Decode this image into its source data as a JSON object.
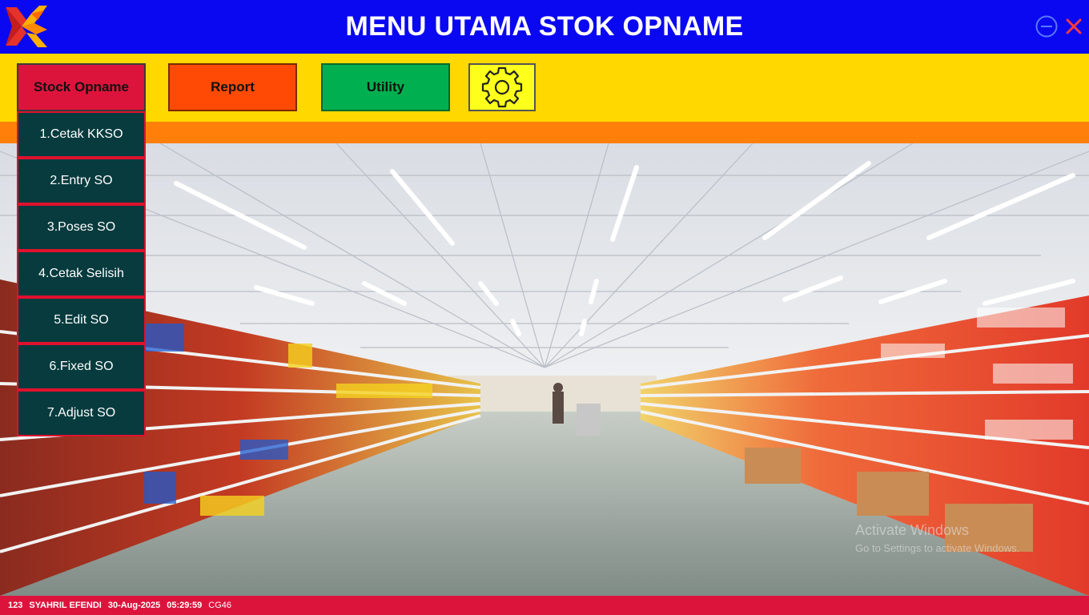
{
  "window": {
    "title": "MENU UTAMA STOK OPNAME",
    "minimize_icon": "minimize-circle-icon",
    "close_icon": "close-icon"
  },
  "toolbar": {
    "stock_opname_label": "Stock Opname",
    "report_label": "Report",
    "utility_label": "Utility",
    "settings_icon": "gear-icon"
  },
  "dropdown": {
    "items": [
      {
        "label": "1.Cetak KKSO"
      },
      {
        "label": "2.Entry SO"
      },
      {
        "label": "3.Poses SO"
      },
      {
        "label": "4.Cetak Selisih"
      },
      {
        "label": "5.Edit SO"
      },
      {
        "label": "6.Fixed SO"
      },
      {
        "label": "7.Adjust SO"
      }
    ]
  },
  "watermark": {
    "line1": "Activate Windows",
    "line2": "Go to Settings to activate Windows."
  },
  "status": {
    "user_id": "123",
    "user_name": "SYAHRIL EFENDI",
    "date": "30-Aug-2025",
    "time": "05:29:59",
    "code": "CG46"
  },
  "colors": {
    "title_bar": "#0a08f0",
    "toolbar": "#ffd800",
    "strip": "#ff7f0a",
    "stock_opname": "#dc143c",
    "report": "#ff4a06",
    "utility": "#00b050",
    "settings": "#ffff1c",
    "menu_item": "#073b3e",
    "status_bar": "#dc143c"
  }
}
